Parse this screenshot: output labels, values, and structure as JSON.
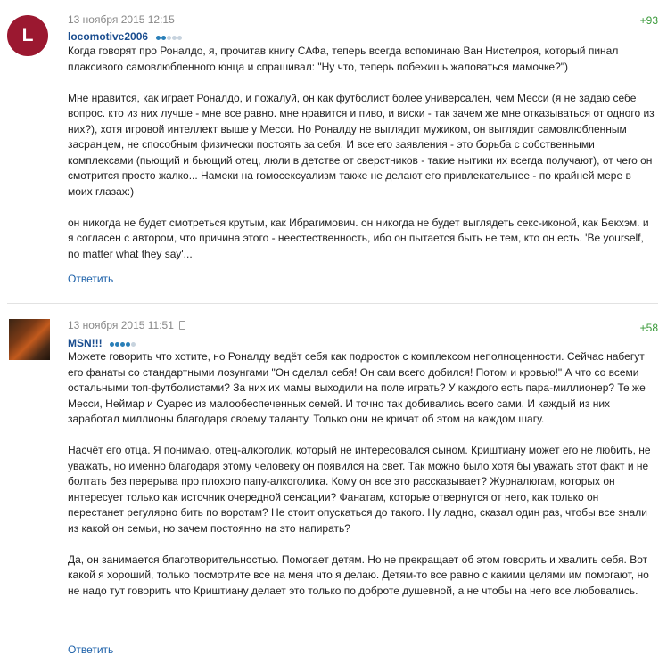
{
  "comments": [
    {
      "avatar_letter": "L",
      "date": "13 ноября 2015 12:15",
      "author": "locomotive2006",
      "rating": "+93",
      "level": 2,
      "paragraphs": [
        "Когда говорят про Роналдо, я, прочитав книгу САФа, теперь всегда вспоминаю Ван Нистелроя, который пинал плаксивого самовлюбленного юнца и спрашивал: \"Ну что, теперь побежишь жаловаться мамочке?\")",
        "Мне нравится, как играет Роналдо, и пожалуй, он как футболист более универсален, чем Месси (я не задаю себе вопрос. кто из них лучше - мне все равно. мне нравится и пиво, и виски - так зачем же мне отказываться от одного из них?), хотя игровой интеллект выше у Месси. Но Роналду не выглядит мужиком, он выглядит самовлюбленным засранцем, не способным физически постоять за себя. И все его заявления - это борьба с собственными комплексами (пьющий и бьющий отец, люли в детстве от сверстников - такие нытики их всегда получают), от чего он смотрится просто жалко... Намеки на гомосексуализм также не делают его привлекательнее - по крайней мере в моих глазах:)",
        "он никогда не будет смотреться крутым, как Ибрагимович. он никогда не будет выглядеть секс-иконой, как Бекхэм. и я согласен с автором, что причина этого - неестественность, ибо он пытается быть не тем, кто он есть. 'Be yourself, no matter what they say'..."
      ],
      "reply_label": "Ответить"
    },
    {
      "date": "13 ноября 2015 11:51",
      "author": "MSN!!!",
      "rating": "+58",
      "level": 4,
      "paragraphs": [
        "Можете говорить что хотите, но Роналду ведёт себя как подросток с комплексом неполноценности. Сейчас набегут его фанаты со стандартными лозунгами \"Он сделал себя! Он сам всего добился! Потом и кровью!\" А что со всеми остальными топ-футболистами? За них их мамы выходили на поле играть? У каждого есть пара-миллионер? Те же Месси, Неймар и Суарес из малообеспеченных семей. И точно так добивались всего сами. И каждый из них заработал миллионы благодаря своему таланту. Только они не кричат об этом на каждом шагу.",
        "Насчёт его отца. Я понимаю, отец-алкоголик, который не интересовался сыном. Криштиану может его не любить, не уважать, но именно благодаря этому человеку он появился на свет. Так можно было хотя бы уважать этот факт и не болтать без перерыва про плохого папу-алкоголика. Кому он все это рассказывает? Журналюгам, которых он интересует только как источник очередной сенсации? Фанатам, которые отвернутся от него, как только он перестанет регулярно бить по воротам? Не стоит опускаться до такого. Ну ладно, сказал один раз, чтобы все знали из какой он семьи, но зачем постоянно на это напирать?",
        "Да, он занимается благотворительностью. Помогает детям. Но не прекращает об этом говорить и хвалить себя. Вот какой я хороший, только посмотрите все на меня что я делаю. Детям-то все равно с какими целями им помогают, но не надо тут говорить что Криштиану делает это только по доброте душевной, а не чтобы на него все любовались."
      ],
      "reply_label": "Ответить"
    }
  ]
}
